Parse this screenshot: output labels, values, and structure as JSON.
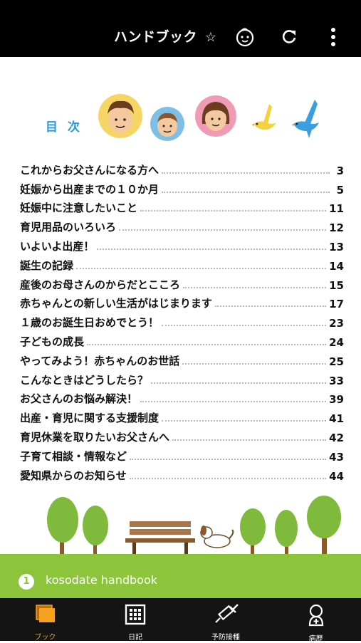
{
  "header": {
    "title": "ハンドブック",
    "star": "☆"
  },
  "toc": {
    "heading": "目次",
    "items": [
      {
        "title": "これからお父さんになる方へ",
        "page": "3"
      },
      {
        "title": "妊娠から出産までの１０か月",
        "page": "5"
      },
      {
        "title": "妊娠中に注意したいこと",
        "page": "11"
      },
      {
        "title": "育児用品のいろいろ",
        "page": "12"
      },
      {
        "title": "いよいよ出産！",
        "page": "13"
      },
      {
        "title": "誕生の記録",
        "page": "14"
      },
      {
        "title": "産後のお母さんのからだとこころ",
        "page": "15"
      },
      {
        "title": "赤ちゃんとの新しい生活がはじまります",
        "page": "17"
      },
      {
        "title": "１歳のお誕生日おめでとう！",
        "page": "23"
      },
      {
        "title": "子どもの成長",
        "page": "24"
      },
      {
        "title": "やってみよう！赤ちゃんのお世話",
        "page": "25"
      },
      {
        "title": "こんなときはどうしたら？",
        "page": "33"
      },
      {
        "title": "お父さんのお悩み解決！",
        "page": "39"
      },
      {
        "title": "出産・育児に関する支援制度",
        "page": "41"
      },
      {
        "title": "育児休業を取りたいお父さんへ",
        "page": "42"
      },
      {
        "title": "子育て相談・情報など",
        "page": "43"
      },
      {
        "title": "愛知県からのお知らせ",
        "page": "44"
      }
    ]
  },
  "footer_band": {
    "page_number": "1",
    "caption": "kosodate handbook"
  },
  "bottom_nav": [
    {
      "label": "ブック",
      "icon": "book-icon",
      "active": true
    },
    {
      "label": "日記",
      "icon": "calendar-icon",
      "active": false
    },
    {
      "label": "予防接種",
      "icon": "syringe-icon",
      "active": false
    },
    {
      "label": "病歴",
      "icon": "medical-history-icon",
      "active": false
    }
  ],
  "colors": {
    "accent_blue": "#2a9bd6",
    "green_band": "#8cc43c",
    "active_nav": "#f4a21f",
    "topbar": "#000000"
  }
}
